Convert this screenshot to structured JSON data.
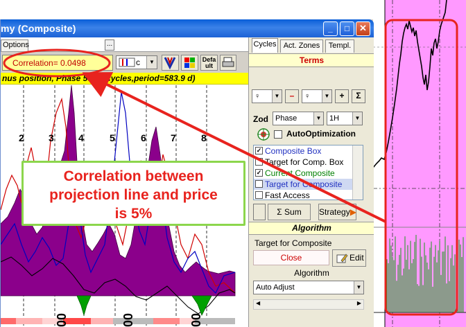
{
  "window": {
    "title": "my (Composite)",
    "buttons": {
      "minimize": "_",
      "maximize": "□",
      "close": "✕"
    }
  },
  "left_panel": {
    "options_tab": "Options",
    "ellipsis": "...",
    "correlation": "Correlation= 0.0498",
    "line_style": {
      "value": "c"
    },
    "default_button": {
      "line1": "Defa",
      "line2": "ult"
    },
    "status": "nus position, Phase 58.67 cycles,period=583.9 d)",
    "cycle_labels": [
      "2",
      "3",
      "4",
      "5",
      "6",
      "7",
      "8"
    ],
    "axis_ticks": [
      "00",
      "00",
      "00"
    ]
  },
  "right_panel": {
    "tabs": [
      "Cycles",
      "Act. Zones",
      "Templ."
    ],
    "terms_header": "Terms",
    "planet_symbol": "♀",
    "minus_label": "–",
    "plus_label": "+",
    "sigma_label": "Σ",
    "zod_label": "Zod",
    "zod_select": "Phase",
    "timeframe_select": "1H",
    "autoopt_label": "AutoOptimization",
    "list_items": [
      {
        "label": "Composite Box",
        "checked": true,
        "color": "#2030c0"
      },
      {
        "label": "Target for Comp. Box",
        "checked": false,
        "color": "#000000"
      },
      {
        "label": "Current Composite",
        "checked": true,
        "color": "#008000"
      },
      {
        "label": "Target for Composite",
        "checked": false,
        "color": "#2030c0"
      },
      {
        "label": "Fast Access",
        "checked": false,
        "color": "#000000"
      }
    ],
    "sum_label": "Sum",
    "strategy_label": "Strategy",
    "algorithm_header": "Algorithm",
    "target_label": "Target for Composite",
    "close_label": "Close",
    "edit_label": "Edit",
    "algorithm_label": "Algorithm",
    "algorithm_select": "Auto Adjust"
  },
  "callout": {
    "line1": "Correlation between",
    "line2": "projection line and price",
    "line3": "is 5%"
  },
  "colors": {
    "annotation_red": "#e8231e",
    "callout_border": "#8cd64c",
    "pink_background": "#ff99ff",
    "histogram_fill": "#8b008b"
  }
}
